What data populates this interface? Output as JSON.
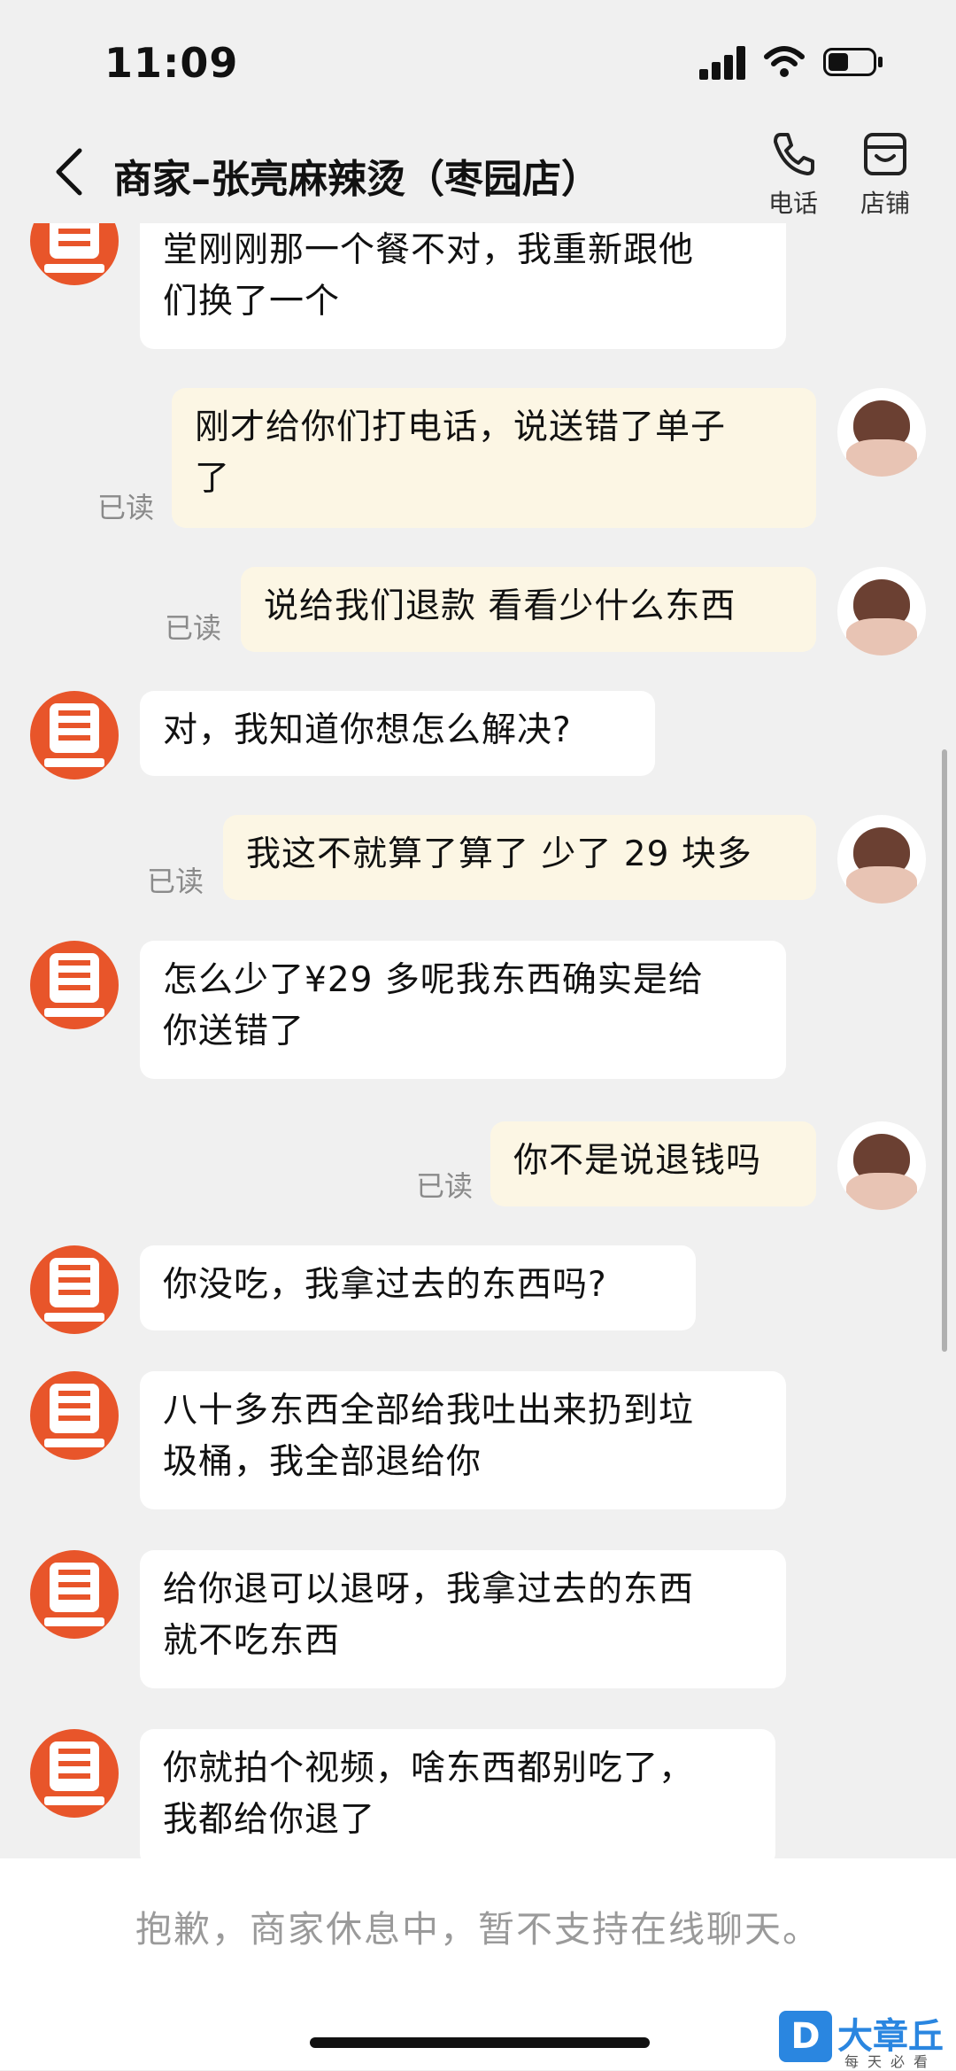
{
  "status": {
    "time": "11:09"
  },
  "header": {
    "title": "商家–张亮麻辣烫（枣园店）",
    "phone_label": "电话",
    "store_label": "店铺"
  },
  "messages": [
    {
      "from": "merchant",
      "text": "堂刚刚那一个餐不对，我重新跟他\n们换了一个"
    },
    {
      "from": "user",
      "text": "刚才给你们打电话，说送错了单子\n了",
      "status": "已读"
    },
    {
      "from": "user",
      "text": "说给我们退款 看看少什么东西",
      "status": "已读"
    },
    {
      "from": "merchant",
      "text": "对，我知道你想怎么解决?"
    },
    {
      "from": "user",
      "text": "我这不就算了算了 少了 29 块多",
      "status": "已读"
    },
    {
      "from": "merchant",
      "text": "怎么少了¥29 多呢我东西确实是给\n你送错了"
    },
    {
      "from": "user",
      "text": "你不是说退钱吗",
      "status": "已读"
    },
    {
      "from": "merchant",
      "text": "你没吃，我拿过去的东西吗?"
    },
    {
      "from": "merchant",
      "text": "八十多东西全部给我吐出来扔到垃\n圾桶，我全部退给你"
    },
    {
      "from": "merchant",
      "text": "给你退可以退呀，我拿过去的东西\n就不吃东西"
    },
    {
      "from": "merchant",
      "text": "你就拍个视频，啥东西都别吃了，\n我都给你退了"
    }
  ],
  "footer": {
    "notice": "抱歉，商家休息中，暂不支持在线聊天。"
  },
  "watermark": {
    "logo": "D",
    "text": "大章丘",
    "sub": "每天必看"
  }
}
